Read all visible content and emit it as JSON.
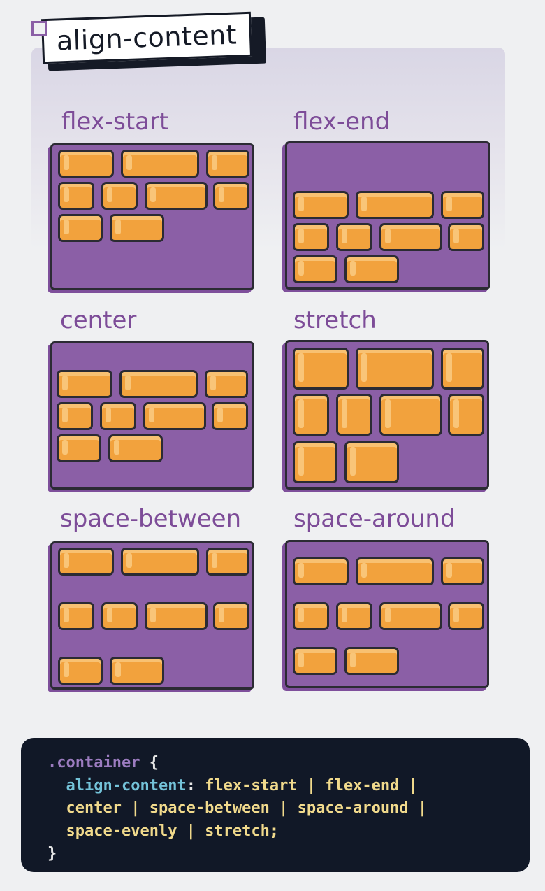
{
  "header": {
    "title": "align-content"
  },
  "colors": {
    "container": "#8b5fa6",
    "item": "#f2a23d",
    "outline": "#2b2b33",
    "label": "#7d4c98",
    "code_bg": "#111827"
  },
  "examples": [
    {
      "label": "flex-start"
    },
    {
      "label": "flex-end"
    },
    {
      "label": "center"
    },
    {
      "label": "stretch"
    },
    {
      "label": "space-between"
    },
    {
      "label": "space-around"
    }
  ],
  "code": {
    "selector": ".container",
    "open_brace": "{",
    "property": "align-content",
    "line1_values": "flex-start | flex-end |",
    "line2_values": "center | space-between | space-around |",
    "line3_values": "space-evenly | stretch;",
    "close_brace": "}"
  }
}
